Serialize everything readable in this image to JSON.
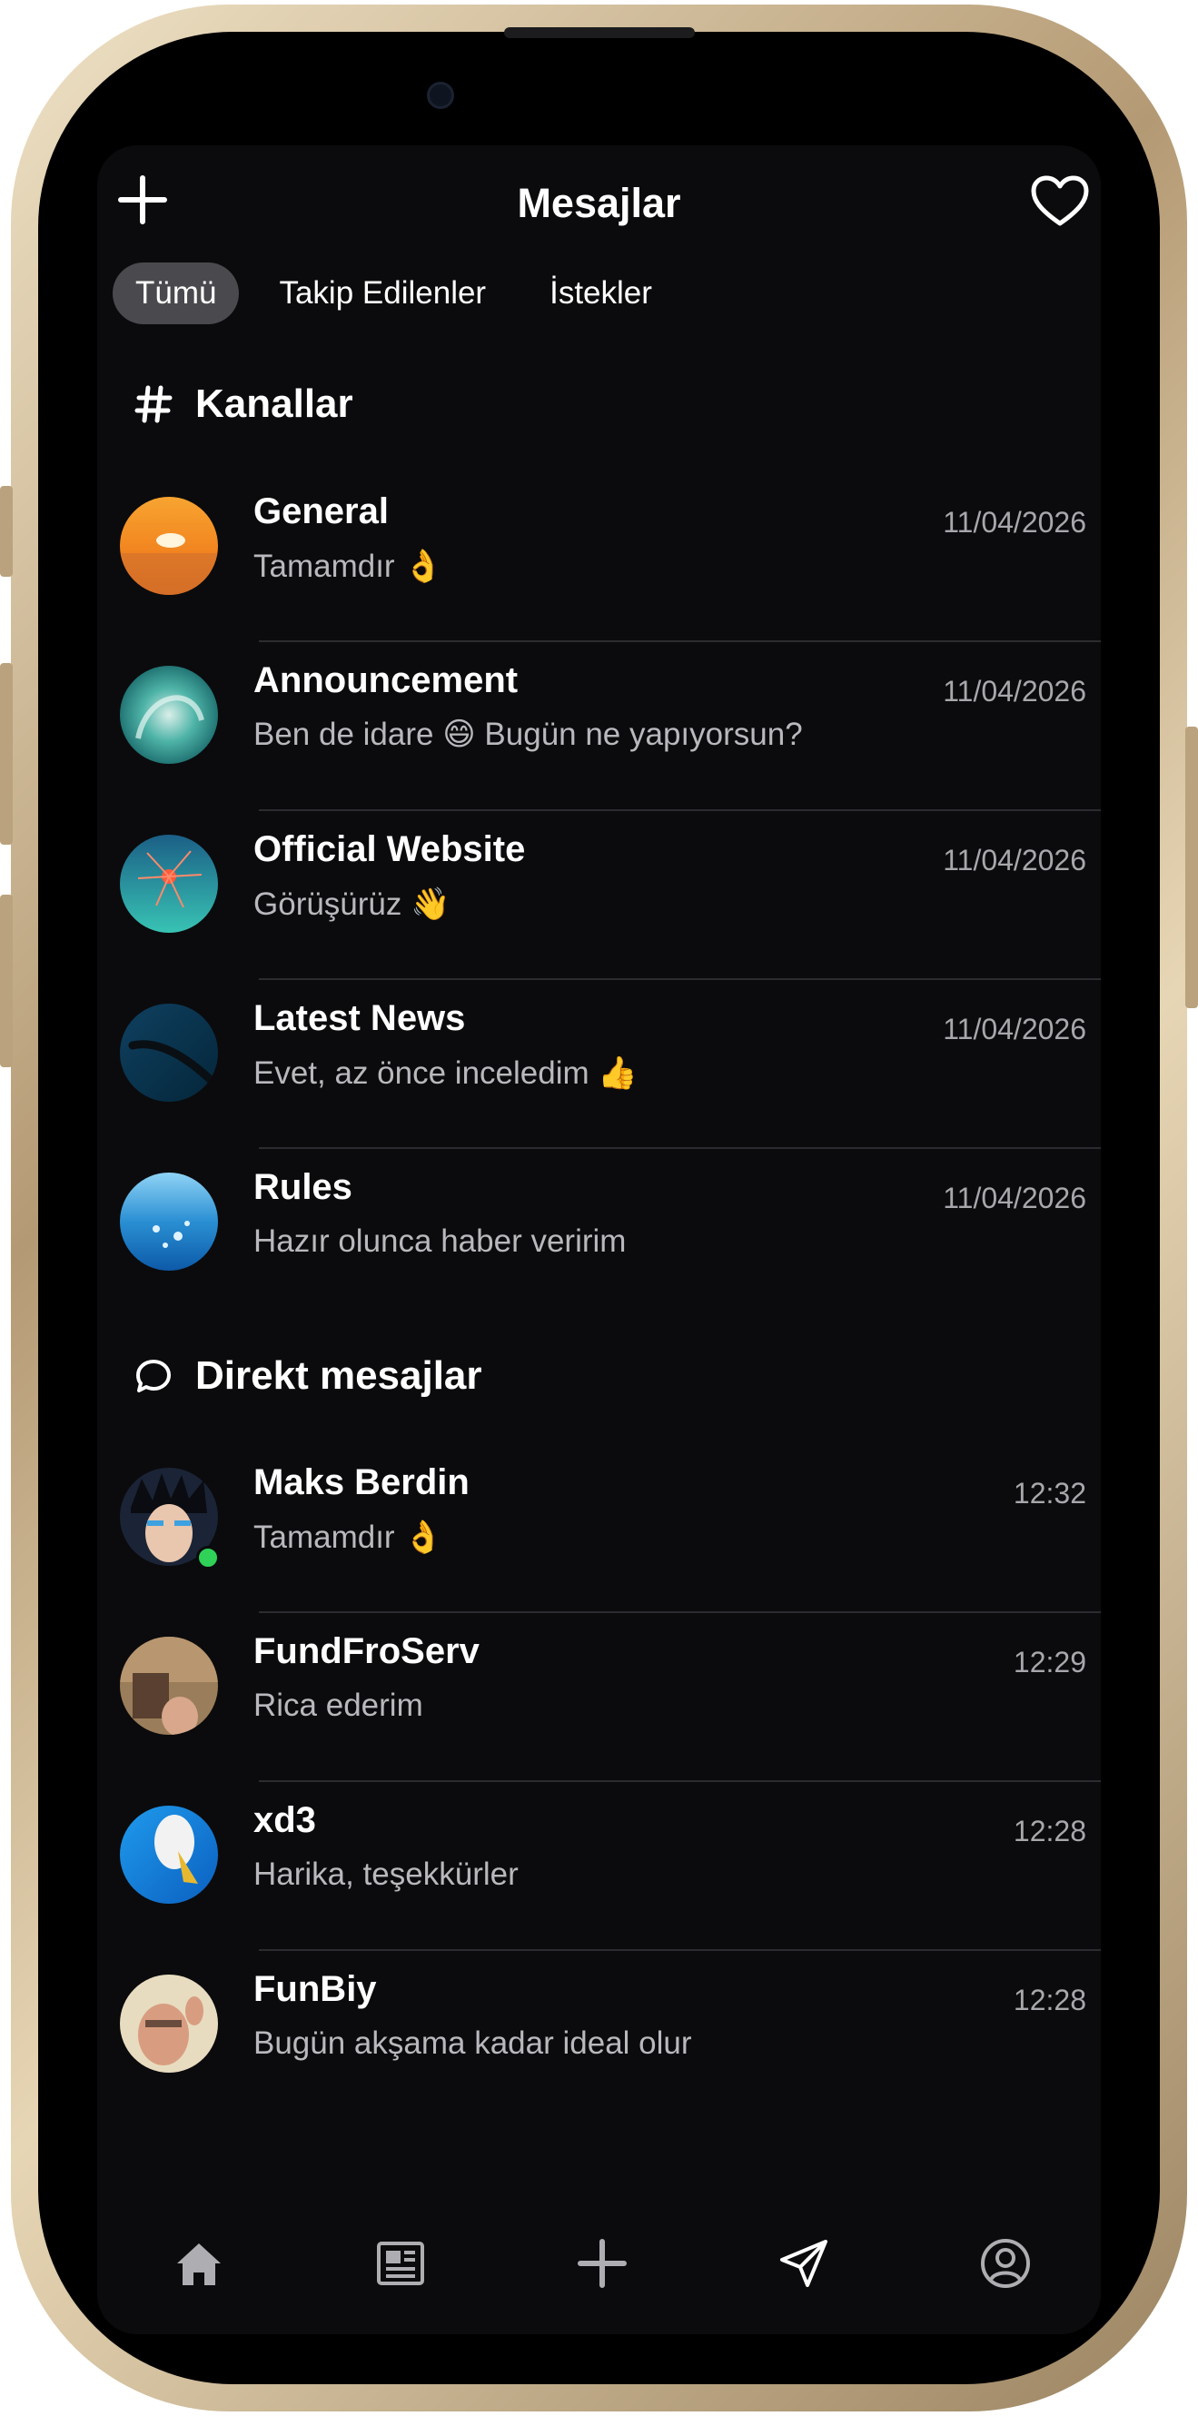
{
  "header": {
    "title": "Mesajlar"
  },
  "tabs": [
    {
      "label": "Tümü",
      "active": true
    },
    {
      "label": "Takip Edilenler",
      "active": false
    },
    {
      "label": "İstekler",
      "active": false
    }
  ],
  "channels": {
    "title": "Kanallar",
    "items": [
      {
        "name": "General",
        "message": "Tamamdır 👌",
        "time": "11/04/2026"
      },
      {
        "name": "Announcement",
        "message": "Ben de idare 😄 Bugün ne yapıyorsun?",
        "time": "11/04/2026"
      },
      {
        "name": "Official Website",
        "message": "Görüşürüz 👋",
        "time": "11/04/2026"
      },
      {
        "name": "Latest News",
        "message": "Evet, az önce inceledim 👍",
        "time": "11/04/2026"
      },
      {
        "name": "Rules",
        "message": "Hazır olunca haber veririm",
        "time": "11/04/2026"
      }
    ]
  },
  "direct": {
    "title": "Direkt mesajlar",
    "items": [
      {
        "name": "Maks Berdin",
        "message": "Tamamdır 👌",
        "time": "12:32",
        "online": true
      },
      {
        "name": "FundFroServ",
        "message": "Rica ederim",
        "time": "12:29"
      },
      {
        "name": "xd3",
        "message": "Harika, teşekkürler",
        "time": "12:28"
      },
      {
        "name": "FunBiy",
        "message": "Bugün akşama kadar ideal olur",
        "time": "12:28"
      }
    ]
  },
  "tabbar": {
    "items": [
      "home-icon",
      "news-icon",
      "add-icon",
      "send-icon",
      "profile-icon"
    ],
    "active_index": 3
  },
  "colors": {
    "background": "#0b0b0d",
    "secondary_text": "#b8b8bd",
    "online": "#2fd158"
  }
}
